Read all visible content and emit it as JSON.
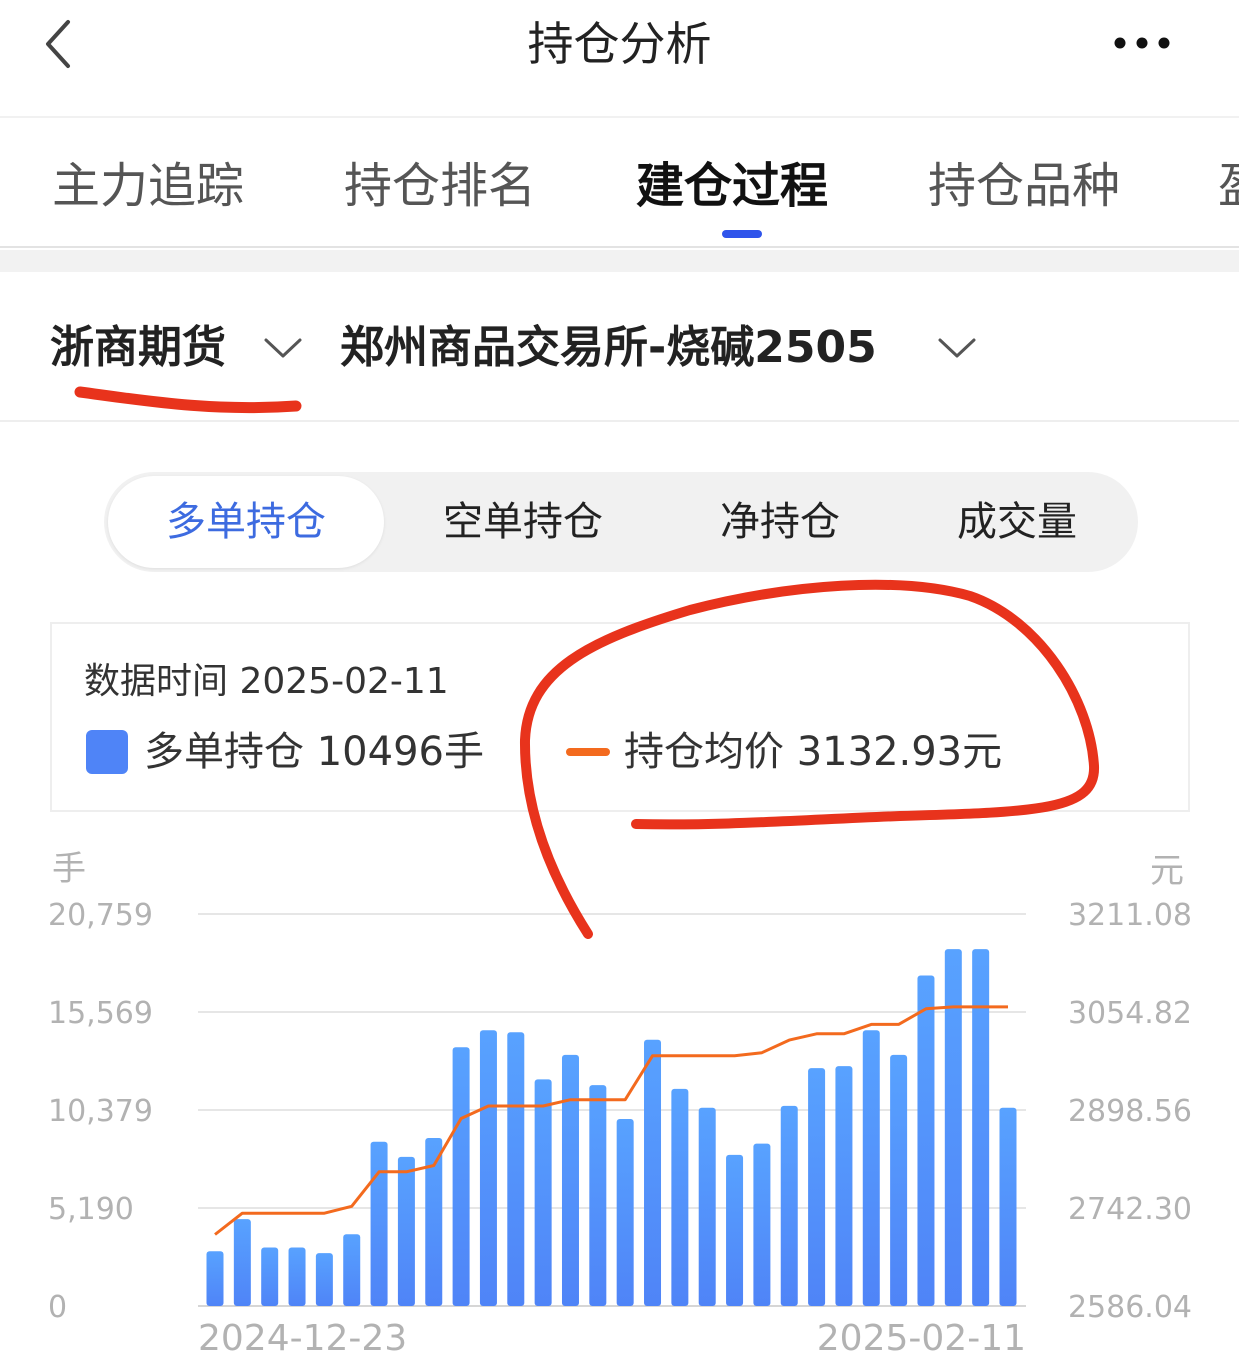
{
  "header": {
    "title": "持仓分析",
    "back_icon": "chevron-left-icon",
    "more_icon": "more-horizontal-icon"
  },
  "tabs": [
    {
      "label": "主力追踪",
      "active": false
    },
    {
      "label": "持仓排名",
      "active": false
    },
    {
      "label": "建仓过程",
      "active": true
    },
    {
      "label": "持仓品种",
      "active": false
    },
    {
      "label": "盈",
      "active": false
    }
  ],
  "selectors": {
    "broker": "浙商期货",
    "contract": "郑州商品交易所-烧碱2505"
  },
  "segments": [
    {
      "label": "多单持仓",
      "active": true
    },
    {
      "label": "空单持仓",
      "active": false
    },
    {
      "label": "净持仓",
      "active": false
    },
    {
      "label": "成交量",
      "active": false
    }
  ],
  "info": {
    "time_label": "数据时间",
    "time_value": "2025-02-11",
    "bar_legend_label": "多单持仓",
    "bar_legend_value": "10496手",
    "line_legend_label": "持仓均价",
    "line_legend_value": "3132.93元"
  },
  "colors": {
    "bar": "#4f84f7",
    "line": "#f36a1e",
    "accent": "#2f54eb",
    "annotation": "#e8331c"
  },
  "chart_data": {
    "type": "bar",
    "left_unit": "手",
    "right_unit": "元",
    "left_ticks": [
      "20,759",
      "15,569",
      "10,379",
      "5,190",
      "0"
    ],
    "right_ticks": [
      "3211.08",
      "3054.82",
      "2898.56",
      "2742.30",
      "2586.04"
    ],
    "ylim_left": [
      0,
      20759
    ],
    "ylim_right": [
      2586.04,
      3211.08
    ],
    "x_start_label": "2024-12-23",
    "x_end_label": "2025-02-11",
    "grid": true,
    "series": [
      {
        "name": "多单持仓",
        "axis": "left",
        "values": [
          2900,
          4600,
          3100,
          3100,
          2800,
          3800,
          8700,
          7900,
          8900,
          13700,
          14600,
          14500,
          12000,
          13300,
          11700,
          9900,
          14100,
          11500,
          10500,
          8000,
          8600,
          10600,
          12600,
          12700,
          14600,
          13300,
          17500,
          18900,
          18900,
          10496
        ]
      },
      {
        "name": "持仓均价",
        "axis": "right",
        "values": [
          2700,
          2734,
          2734,
          2734,
          2734,
          2745,
          2800,
          2800,
          2810,
          2885,
          2905,
          2905,
          2905,
          2915,
          2915,
          2915,
          2985,
          2985,
          2985,
          2985,
          2990,
          3010,
          3020,
          3020,
          3035,
          3035,
          3060,
          3063,
          3063,
          3063
        ]
      }
    ]
  }
}
